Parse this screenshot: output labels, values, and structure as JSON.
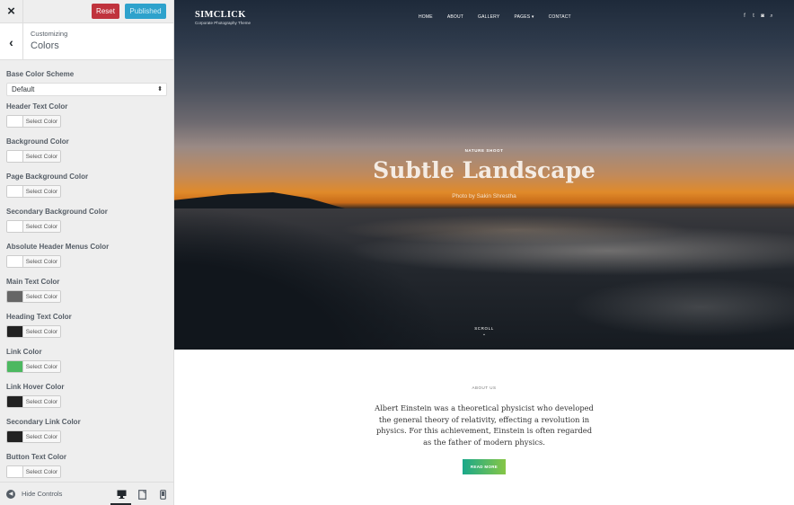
{
  "sidebar": {
    "close_icon": "×",
    "reset_label": "Reset",
    "published_label": "Published",
    "back_icon": "‹",
    "subtitle": "Customizing",
    "title": "Colors",
    "base_scheme": {
      "label": "Base Color Scheme",
      "value": "Default"
    },
    "select_color_label": "Select Color",
    "colors": [
      {
        "label": "Header Text Color",
        "color": "#ffffff"
      },
      {
        "label": "Background Color",
        "color": "#ffffff"
      },
      {
        "label": "Page Background Color",
        "color": "#ffffff"
      },
      {
        "label": "Secondary Background Color",
        "color": "#ffffff"
      },
      {
        "label": "Absolute Header Menus Color",
        "color": "#ffffff"
      },
      {
        "label": "Main Text Color",
        "color": "#666666"
      },
      {
        "label": "Heading Text Color",
        "color": "#222222"
      },
      {
        "label": "Link Color",
        "color": "#4cb860"
      },
      {
        "label": "Link Hover Color",
        "color": "#222222"
      },
      {
        "label": "Secondary Link Color",
        "color": "#222222"
      },
      {
        "label": "Button Text Color",
        "color": "#ffffff"
      }
    ],
    "footer": {
      "hide_controls": "Hide Controls",
      "active_device": "desktop"
    }
  },
  "preview": {
    "site_title": "SIMCLICK",
    "site_tagline": "Corporate Photography Theme",
    "nav": [
      "HOME",
      "ABOUT",
      "GALLERY",
      "PAGES ▾",
      "CONTACT"
    ],
    "social": [
      "f",
      "t",
      "◙",
      "⌕"
    ],
    "hero": {
      "kicker": "NATURE SHOOT",
      "title": "Subtle Landscape",
      "credit": "Photo by Sakin Shrestha",
      "scroll": "SCROLL",
      "scroll_arrow": "⌄"
    },
    "about": {
      "label": "ABOUT US",
      "text": "Albert Einstein was a theoretical physicist who developed the general theory of relativity, effecting a revolution in physics. For this achievement, Einstein is often regarded as the father of modern physics.",
      "button": "READ MORE"
    }
  }
}
